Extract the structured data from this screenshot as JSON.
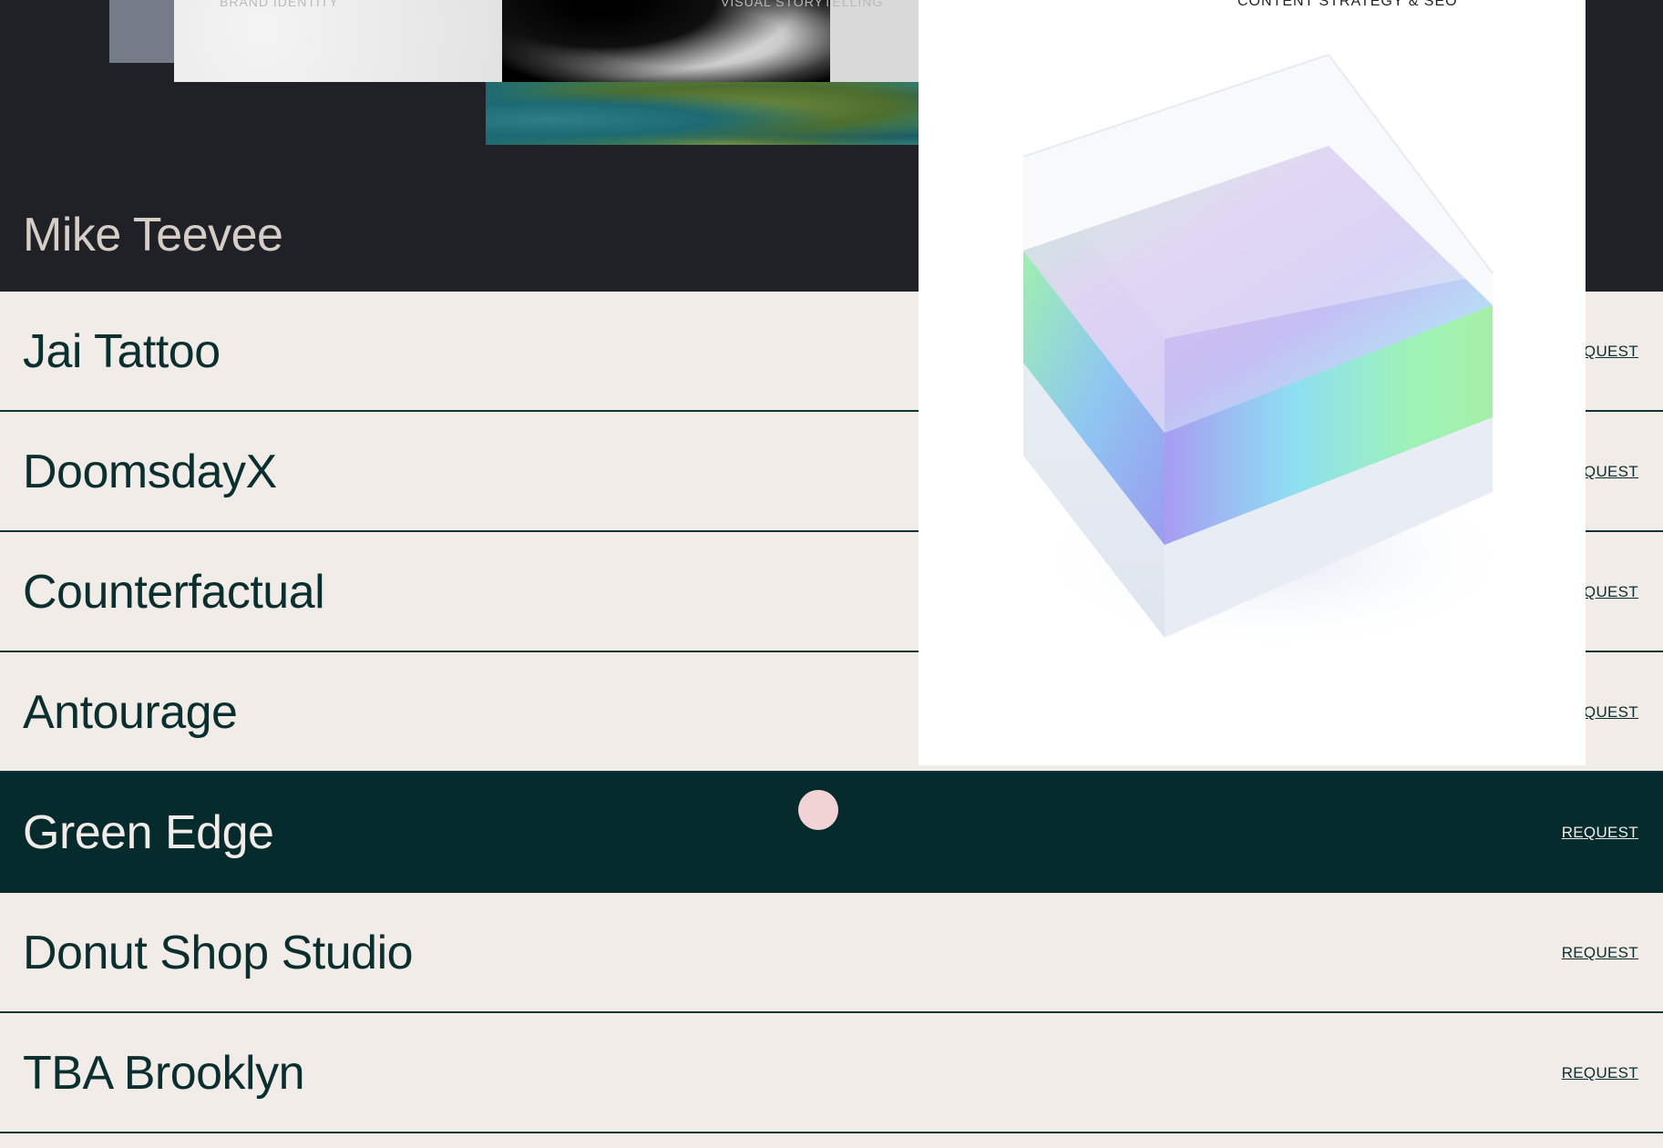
{
  "header": {
    "person_name": "Mike Teevee",
    "captions": {
      "brand_identity": "BRAND IDENTITY",
      "visual_storytelling": "VISUAL STORYTELLING"
    }
  },
  "projects": [
    {
      "name": "Jai Tattoo",
      "action": "REQUEST"
    },
    {
      "name": "DoomsdayX",
      "action": "REQUEST"
    },
    {
      "name": "Counterfactual",
      "action": "REQUEST"
    },
    {
      "name": "Antourage",
      "action": "REQUEST"
    },
    {
      "name": "Green Edge",
      "action": "REQUEST",
      "active": true
    },
    {
      "name": "Donut Shop Studio",
      "action": "REQUEST"
    },
    {
      "name": "TBA Brooklyn",
      "action": "REQUEST"
    }
  ],
  "preview": {
    "caption": "CONTENT STRATEGY & SEO"
  },
  "colors": {
    "dark_header": "#1f2126",
    "list_background": "#f1ece8",
    "active_row": "#052b2c",
    "text_dark": "#0b2e2e",
    "cursor": "#f2d3d5"
  }
}
